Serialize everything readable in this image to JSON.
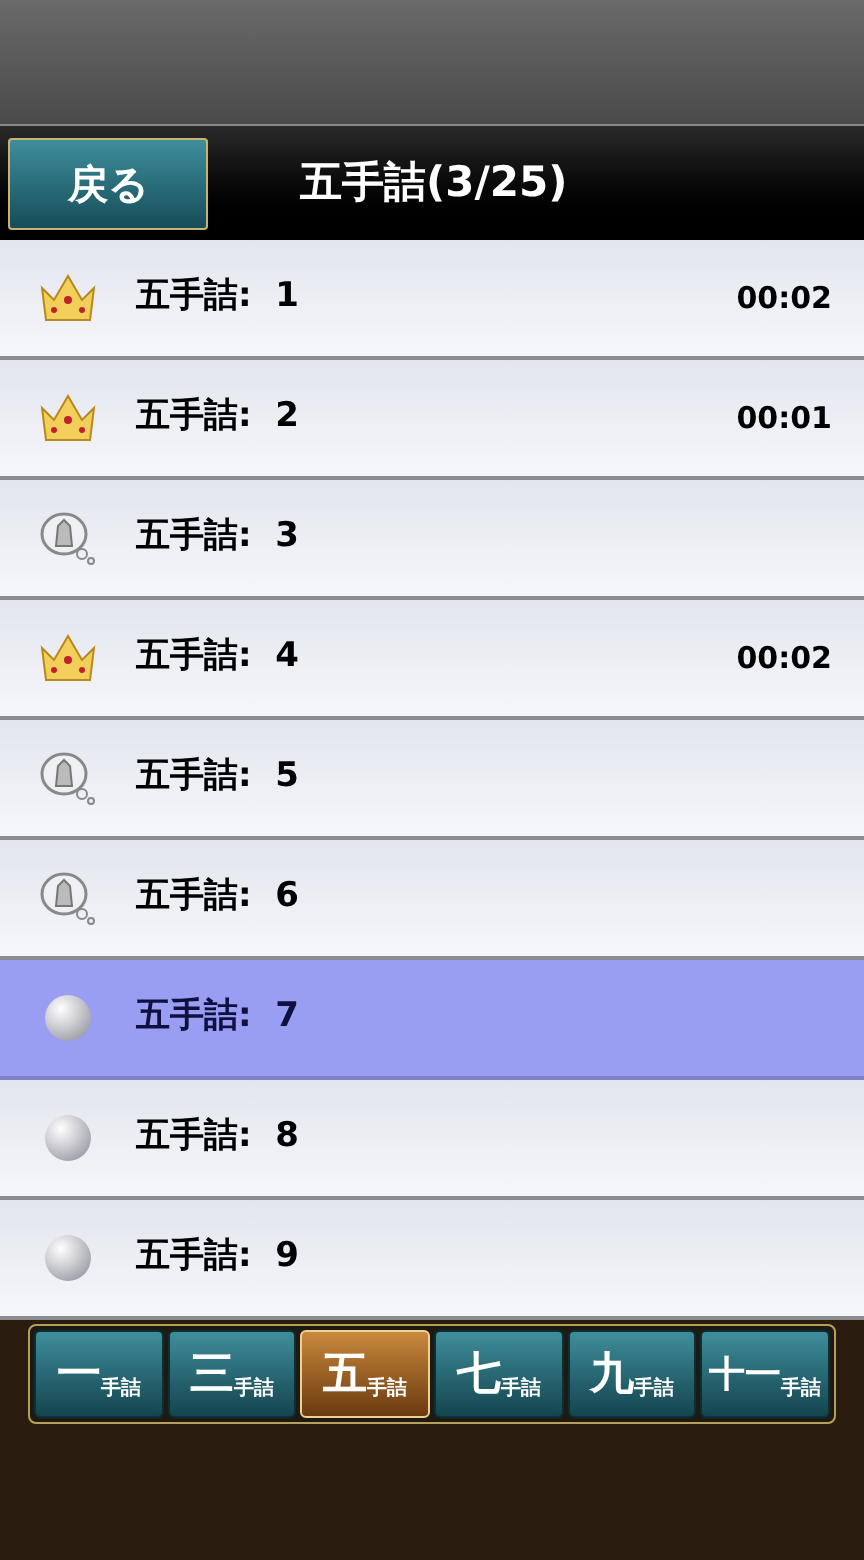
{
  "header": {
    "back_button": "戻る",
    "title": "五手詰(3/25)"
  },
  "problems": [
    {
      "label": "五手詰:  1",
      "kind": "crown",
      "time": "00:02",
      "selected": false
    },
    {
      "label": "五手詰:  2",
      "kind": "crown",
      "time": "00:01",
      "selected": false
    },
    {
      "label": "五手詰:  3",
      "kind": "bubble",
      "selected": false
    },
    {
      "label": "五手詰:  4",
      "kind": "crown",
      "time": "00:02",
      "selected": false
    },
    {
      "label": "五手詰:  5",
      "kind": "bubble",
      "selected": false
    },
    {
      "label": "五手詰:  6",
      "kind": "bubble",
      "selected": false
    },
    {
      "label": "五手詰:  7",
      "kind": "circle",
      "selected": true
    },
    {
      "label": "五手詰:  8",
      "kind": "circle",
      "selected": false
    },
    {
      "label": "五手詰:  9",
      "kind": "circle",
      "selected": false
    }
  ],
  "tabs": [
    {
      "number": "一",
      "suffix": "手詰",
      "selected": false
    },
    {
      "number": "三",
      "suffix": "手詰",
      "selected": false
    },
    {
      "number": "五",
      "suffix": "手詰",
      "selected": true
    },
    {
      "number": "七",
      "suffix": "手詰",
      "selected": false
    },
    {
      "number": "九",
      "suffix": "手詰",
      "selected": false
    },
    {
      "number": "十一",
      "suffix": "手詰",
      "selected": false
    }
  ]
}
